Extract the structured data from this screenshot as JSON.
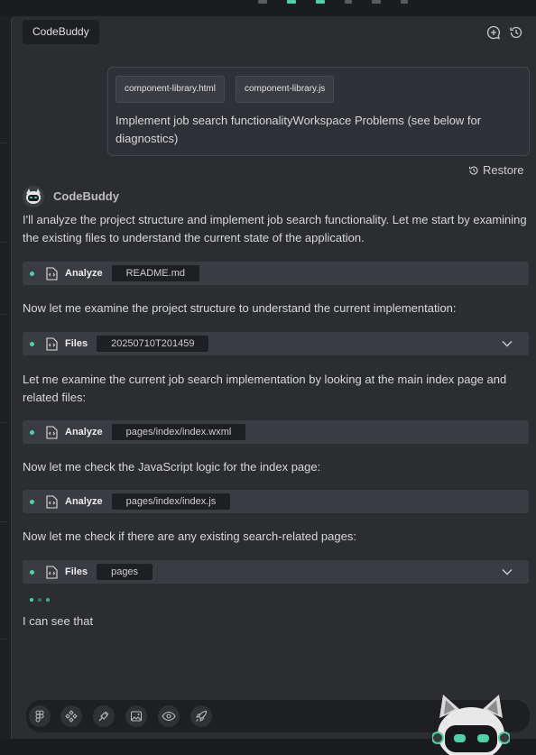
{
  "panel": {
    "title": "CodeBuddy"
  },
  "header_icons": [
    "new-chat-icon",
    "history-icon"
  ],
  "user_message": {
    "attachments": [
      "component-library.html",
      "component-library.js"
    ],
    "text": "Implement job search functionalityWorkspace Problems (see below for diagnostics)"
  },
  "restore_label": "Restore",
  "assistant_name": "CodeBuddy",
  "messages": [
    "I'll analyze the project structure and implement job search functionality. Let me start by examining the existing files to understand the current state of the application.",
    "Now let me examine the project structure to understand the current implementation:",
    "Let me examine the current job search implementation by looking at the main index page and related files:",
    "Now let me check the JavaScript logic for the index page:",
    "Now let me check if there are any existing search-related pages:",
    "I can see that"
  ],
  "tools": [
    {
      "label": "Analyze",
      "value": "README.md",
      "expandable": false
    },
    {
      "label": "Files",
      "value": "20250710T201459",
      "expandable": true
    },
    {
      "label": "Analyze",
      "value": "pages/index/index.wxml",
      "expandable": false
    },
    {
      "label": "Analyze",
      "value": "pages/index/index.js",
      "expandable": false
    },
    {
      "label": "Files",
      "value": "pages",
      "expandable": true
    }
  ],
  "input_toolbar_icons": [
    "figma-icon",
    "component-icon",
    "plugin-icon",
    "image-upload-icon",
    "preview-eye-icon",
    "deploy-rocket-icon"
  ],
  "colors": {
    "accent": "#4fd1a5",
    "panel_bg": "#2b2d31",
    "tool_bg": "#3a3c41",
    "chip_bg": "#1e1f22"
  }
}
